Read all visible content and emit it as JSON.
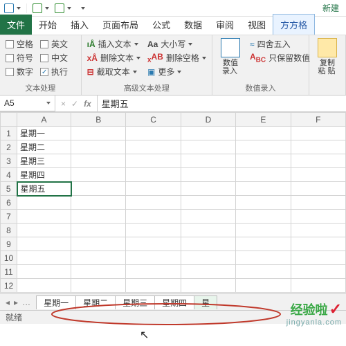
{
  "qat": {
    "title": "新建"
  },
  "tabs": {
    "file": "文件",
    "items": [
      "开始",
      "插入",
      "页面布局",
      "公式",
      "数据",
      "审阅",
      "视图",
      "方方格"
    ]
  },
  "ribbon": {
    "group1": {
      "title": "文本处理",
      "checks": [
        [
          "空格",
          false
        ],
        [
          "英文",
          false
        ],
        [
          "符号",
          false
        ],
        [
          "中文",
          false
        ],
        [
          "数字",
          false
        ],
        [
          "执行",
          true
        ]
      ]
    },
    "group2": {
      "title": "高级文本处理",
      "rows": [
        "插入文本",
        "删除文本",
        "截取文本"
      ],
      "rows2": [
        "大小写",
        "删除空格",
        "更多"
      ]
    },
    "group3": {
      "title": "数值录入",
      "big": "数值\n录入",
      "rows": [
        "四舍五入",
        "只保留数值"
      ]
    },
    "group4": {
      "big": "复制粘\n贴"
    }
  },
  "namebox": "A5",
  "formula": "星期五",
  "columns": [
    "",
    "A",
    "B",
    "C",
    "D",
    "E",
    "F"
  ],
  "rows": [
    [
      "1",
      "星期一",
      "",
      "",
      "",
      "",
      ""
    ],
    [
      "2",
      "星期二",
      "",
      "",
      "",
      "",
      ""
    ],
    [
      "3",
      "星期三",
      "",
      "",
      "",
      "",
      ""
    ],
    [
      "4",
      "星期四",
      "",
      "",
      "",
      "",
      ""
    ],
    [
      "5",
      "星期五",
      "",
      "",
      "",
      "",
      ""
    ],
    [
      "6",
      "",
      "",
      "",
      "",
      "",
      ""
    ],
    [
      "7",
      "",
      "",
      "",
      "",
      "",
      ""
    ],
    [
      "8",
      "",
      "",
      "",
      "",
      "",
      ""
    ],
    [
      "9",
      "",
      "",
      "",
      "",
      "",
      ""
    ],
    [
      "10",
      "",
      "",
      "",
      "",
      "",
      ""
    ],
    [
      "11",
      "",
      "",
      "",
      "",
      "",
      ""
    ],
    [
      "12",
      "",
      "",
      "",
      "",
      "",
      ""
    ]
  ],
  "sheet_tabs": [
    "星期一",
    "星期二",
    "星期三",
    "星期四",
    "星"
  ],
  "status": "就绪",
  "watermark": {
    "brand": "经验啦",
    "url": "jingyanla.com"
  }
}
